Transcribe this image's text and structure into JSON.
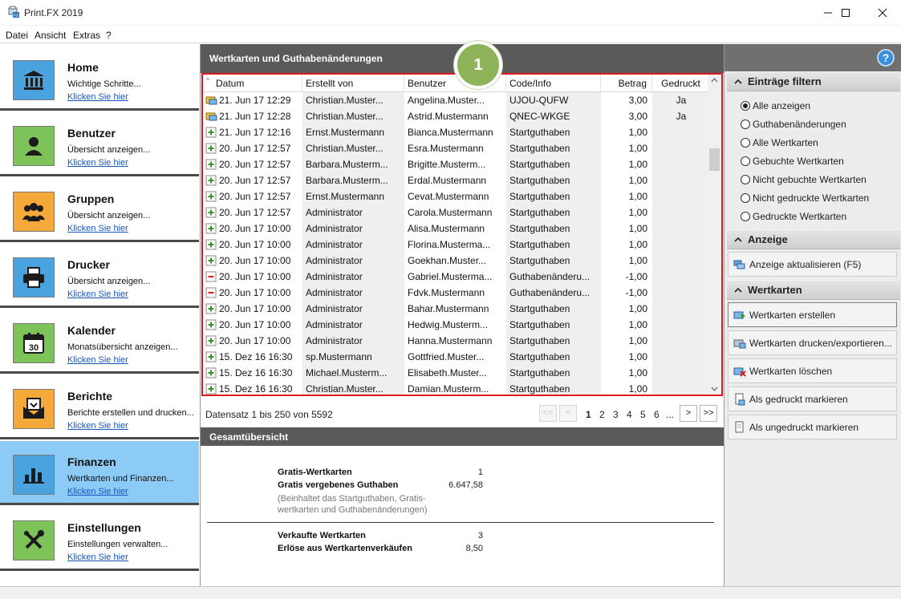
{
  "window": {
    "title": "Print.FX 2019",
    "icon": "printfx-app-icon"
  },
  "menu": [
    "Datei",
    "Ansicht",
    "Extras",
    "?"
  ],
  "nav": {
    "items": [
      {
        "title": "Home",
        "desc": "Wichtige Schritte...",
        "link": "Klicken Sie hier",
        "icon": "bank-icon",
        "color": "#4aa3df",
        "active": false
      },
      {
        "title": "Benutzer",
        "desc": "Übersicht anzeigen...",
        "link": "Klicken Sie hier",
        "icon": "user-icon",
        "color": "#7ec35a",
        "active": false
      },
      {
        "title": "Gruppen",
        "desc": "Übersicht anzeigen...",
        "link": "Klicken Sie hier",
        "icon": "group-icon",
        "color": "#f5a93b",
        "active": false
      },
      {
        "title": "Drucker",
        "desc": "Übersicht anzeigen...",
        "link": "Klicken Sie hier",
        "icon": "printer-icon",
        "color": "#4aa3df",
        "active": false
      },
      {
        "title": "Kalender",
        "desc": "Monatsübersicht anzeigen...",
        "link": "Klicken Sie hier",
        "icon": "calendar-icon",
        "color": "#7ec35a",
        "active": false
      },
      {
        "title": "Berichte",
        "desc": "Berichte erstellen und drucken...",
        "link": "Klicken Sie hier",
        "icon": "report-icon",
        "color": "#f5a93b",
        "active": false
      },
      {
        "title": "Finanzen",
        "desc": "Wertkarten und Finanzen...",
        "link": "Klicken Sie hier",
        "icon": "finance-chart-icon",
        "color": "#4aa3df",
        "active": true
      },
      {
        "title": "Einstellungen",
        "desc": "Einstellungen verwalten...",
        "link": "Klicken Sie hier",
        "icon": "tools-icon",
        "color": "#7ec35a",
        "active": false
      }
    ]
  },
  "main": {
    "header": "Wertkarten und Guthabenänderungen",
    "callout": "1",
    "columns": [
      "Datum",
      "Erstellt von",
      "Benutzer",
      "Code/Info",
      "Betrag",
      "Gedruckt"
    ],
    "rows": [
      {
        "type": "card",
        "datum": "21. Jun 17 12:29",
        "von": "Christian.Muster...",
        "benutzer": "Angelina.Muster...",
        "code": "UJOU-QUFW",
        "betrag": "3,00",
        "gedruckt": "Ja"
      },
      {
        "type": "card",
        "datum": "21. Jun 17 12:28",
        "von": "Christian.Muster...",
        "benutzer": "Astrid.Mustermann",
        "code": "QNEC-WKGE",
        "betrag": "3,00",
        "gedruckt": "Ja"
      },
      {
        "type": "plus",
        "datum": "21. Jun 17 12:16",
        "von": "Ernst.Mustermann",
        "benutzer": "Bianca.Mustermann",
        "code": "Startguthaben",
        "betrag": "1,00",
        "gedruckt": ""
      },
      {
        "type": "plus",
        "datum": "20. Jun 17 12:57",
        "von": "Christian.Muster...",
        "benutzer": "Esra.Mustermann",
        "code": "Startguthaben",
        "betrag": "1,00",
        "gedruckt": ""
      },
      {
        "type": "plus",
        "datum": "20. Jun 17 12:57",
        "von": "Barbara.Musterm...",
        "benutzer": "Brigitte.Musterm...",
        "code": "Startguthaben",
        "betrag": "1,00",
        "gedruckt": ""
      },
      {
        "type": "plus",
        "datum": "20. Jun 17 12:57",
        "von": "Barbara.Musterm...",
        "benutzer": "Erdal.Mustermann",
        "code": "Startguthaben",
        "betrag": "1,00",
        "gedruckt": ""
      },
      {
        "type": "plus",
        "datum": "20. Jun 17 12:57",
        "von": "Ernst.Mustermann",
        "benutzer": "Cevat.Mustermann",
        "code": "Startguthaben",
        "betrag": "1,00",
        "gedruckt": ""
      },
      {
        "type": "plus",
        "datum": "20. Jun 17 12:57",
        "von": "Administrator",
        "benutzer": "Carola.Mustermann",
        "code": "Startguthaben",
        "betrag": "1,00",
        "gedruckt": ""
      },
      {
        "type": "plus",
        "datum": "20. Jun 17 10:00",
        "von": "Administrator",
        "benutzer": "Alisa.Mustermann",
        "code": "Startguthaben",
        "betrag": "1,00",
        "gedruckt": ""
      },
      {
        "type": "plus",
        "datum": "20. Jun 17 10:00",
        "von": "Administrator",
        "benutzer": "Florina.Musterma...",
        "code": "Startguthaben",
        "betrag": "1,00",
        "gedruckt": ""
      },
      {
        "type": "plus",
        "datum": "20. Jun 17 10:00",
        "von": "Administrator",
        "benutzer": "Goekhan.Muster...",
        "code": "Startguthaben",
        "betrag": "1,00",
        "gedruckt": ""
      },
      {
        "type": "minus",
        "datum": "20. Jun 17 10:00",
        "von": "Administrator",
        "benutzer": "Gabriel.Musterma...",
        "code": "Guthabenänderu...",
        "betrag": "-1,00",
        "gedruckt": ""
      },
      {
        "type": "minus",
        "datum": "20. Jun 17 10:00",
        "von": "Administrator",
        "benutzer": "Fdvk.Mustermann",
        "code": "Guthabenänderu...",
        "betrag": "-1,00",
        "gedruckt": ""
      },
      {
        "type": "plus",
        "datum": "20. Jun 17 10:00",
        "von": "Administrator",
        "benutzer": "Bahar.Mustermann",
        "code": "Startguthaben",
        "betrag": "1,00",
        "gedruckt": ""
      },
      {
        "type": "plus",
        "datum": "20. Jun 17 10:00",
        "von": "Administrator",
        "benutzer": "Hedwig.Musterm...",
        "code": "Startguthaben",
        "betrag": "1,00",
        "gedruckt": ""
      },
      {
        "type": "plus",
        "datum": "20. Jun 17 10:00",
        "von": "Administrator",
        "benutzer": "Hanna.Mustermann",
        "code": "Startguthaben",
        "betrag": "1,00",
        "gedruckt": ""
      },
      {
        "type": "plus",
        "datum": "15. Dez 16 16:30",
        "von": "sp.Mustermann",
        "benutzer": "Gottfried.Muster...",
        "code": "Startguthaben",
        "betrag": "1,00",
        "gedruckt": ""
      },
      {
        "type": "plus",
        "datum": "15. Dez 16 16:30",
        "von": "Michael.Musterm...",
        "benutzer": "Elisabeth.Muster...",
        "code": "Startguthaben",
        "betrag": "1,00",
        "gedruckt": ""
      },
      {
        "type": "plus",
        "datum": "15. Dez 16 16:30",
        "von": "Christian.Muster...",
        "benutzer": "Damian.Musterm...",
        "code": "Startguthaben",
        "betrag": "1,00",
        "gedruckt": ""
      }
    ],
    "pager": {
      "info": "Datensatz 1 bis 250 von 5592",
      "first": "<<",
      "prev": "<",
      "pages": [
        "1",
        "2",
        "3",
        "4",
        "5",
        "6",
        "..."
      ],
      "current": "1",
      "next": ">",
      "last": ">>"
    },
    "summary": {
      "header": "Gesamtübersicht",
      "gratis_label": "Gratis-Wertkarten",
      "gratis_value": "1",
      "guthaben_label": "Gratis vergebenes Guthaben",
      "guthaben_value": "6.647,58",
      "note_line1": "(Beinhaltet das Startguthaben, Gratis-",
      "note_line2": "wertkarten und Guthabenänderungen)",
      "verkauft_label": "Verkaufte Wertkarten",
      "verkauft_value": "3",
      "erloese_label": "Erlöse aus Wertkartenverkäufen",
      "erloese_value": "8,50"
    }
  },
  "right": {
    "help_icon": "help-icon",
    "filter_header": "Einträge filtern",
    "filters": [
      {
        "label": "Alle anzeigen",
        "selected": true
      },
      {
        "label": "Guthabenänderungen",
        "selected": false
      },
      {
        "label": "Alle Wertkarten",
        "selected": false
      },
      {
        "label": "Gebuchte Wertkarten",
        "selected": false
      },
      {
        "label": "Nicht gebuchte Wertkarten",
        "selected": false
      },
      {
        "label": "Nicht gedruckte Wertkarten",
        "selected": false
      },
      {
        "label": "Gedruckte Wertkarten",
        "selected": false
      }
    ],
    "anzeige_header": "Anzeige",
    "refresh_label": "Anzeige aktualisieren (F5)",
    "wertkarten_header": "Wertkarten",
    "actions": [
      {
        "label": "Wertkarten erstellen",
        "icon": "card-add-icon"
      },
      {
        "label": "Wertkarten drucken/exportieren...",
        "icon": "card-print-icon"
      },
      {
        "label": "Wertkarten löschen",
        "icon": "card-delete-icon"
      },
      {
        "label": "Als gedruckt markieren",
        "icon": "mark-printed-icon"
      },
      {
        "label": "Als ungedruckt markieren",
        "icon": "mark-unprinted-icon"
      }
    ]
  },
  "colors": {
    "accent_active": "#8ccbf5",
    "header_dark": "#5a5a5a",
    "highlight_red": "#e0151f",
    "callout_green": "#8fb359",
    "link_blue": "#1a56b8"
  }
}
